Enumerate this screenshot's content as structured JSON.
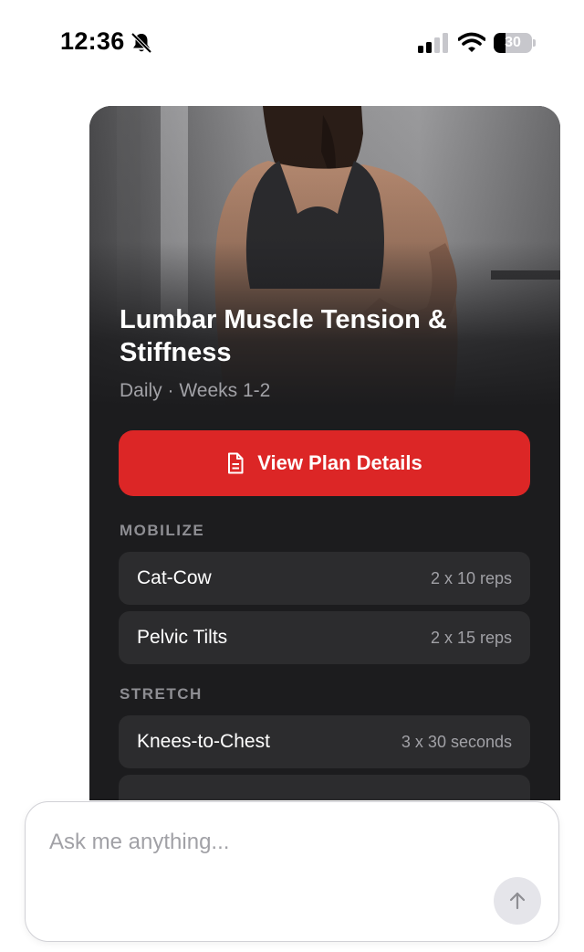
{
  "status_bar": {
    "time": "12:36",
    "battery_level": "30",
    "battery_fraction": 0.3,
    "icons": [
      "bell-slash-icon",
      "signal-icon",
      "wifi-icon",
      "battery-icon"
    ]
  },
  "plan": {
    "title": "Lumbar Muscle Tension & Stiffness",
    "subtitle": "Daily · Weeks 1-2",
    "button_label": "View Plan Details",
    "button_icon": "document-icon",
    "accent_color": "#dc2626",
    "sections": [
      {
        "label": "MOBILIZE",
        "exercises": [
          {
            "name": "Cat-Cow",
            "dose": "2 x 10 reps"
          },
          {
            "name": "Pelvic Tilts",
            "dose": "2 x 15 reps"
          }
        ]
      },
      {
        "label": "STRETCH",
        "exercises": [
          {
            "name": "Knees-to-Chest",
            "dose": "3 x 30 seconds"
          }
        ]
      }
    ]
  },
  "chat": {
    "placeholder": "Ask me anything...",
    "send_icon": "arrow-up-icon"
  }
}
